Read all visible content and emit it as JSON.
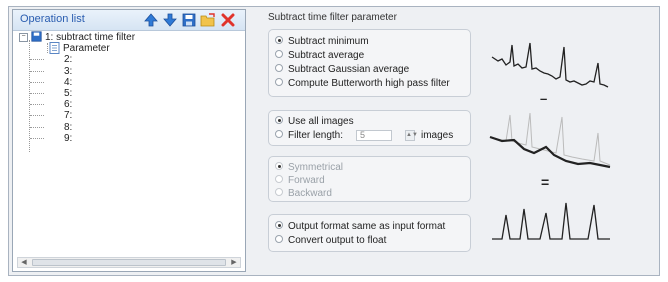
{
  "operation_list": {
    "title": "Operation list",
    "toolbar": {
      "up_icon": "arrow-up-icon",
      "down_icon": "arrow-down-icon",
      "save_icon": "save-icon",
      "open_icon": "folder-open-icon",
      "delete_icon": "delete-icon"
    },
    "root_label": "1: subtract time filter",
    "child_label": "Parameter",
    "slots": [
      "2:",
      "3:",
      "4:",
      "5:",
      "6:",
      "7:",
      "8:",
      "9:"
    ]
  },
  "params": {
    "title": "Subtract time filter parameter",
    "methods": [
      {
        "label": "Subtract minimum",
        "selected": true
      },
      {
        "label": "Subtract average",
        "selected": false
      },
      {
        "label": "Subtract Gaussian average",
        "selected": false
      },
      {
        "label": "Compute Butterworth high pass filter",
        "selected": false
      }
    ],
    "range": {
      "use_all_label": "Use all images",
      "filter_length_label": "Filter length:",
      "filter_length_value": "5",
      "images_label": "images"
    },
    "direction": [
      "Symmetrical",
      "Forward",
      "Backward"
    ],
    "output": {
      "same_label": "Output format same as input format",
      "float_label": "Convert output to float"
    }
  },
  "illustration": {
    "minus": "–",
    "equals": "="
  },
  "colors": {
    "title_blue": "#2a5db0",
    "panel_bg": "#eef0f3",
    "border": "#a9b3c0"
  }
}
